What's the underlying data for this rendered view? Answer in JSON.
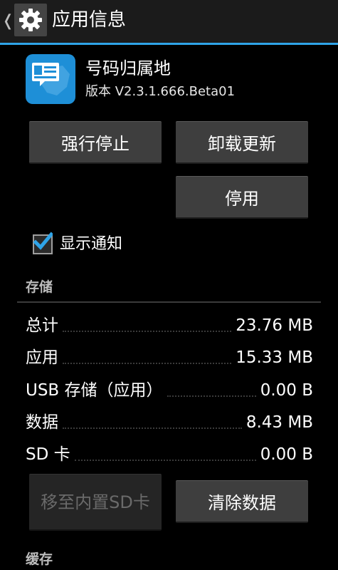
{
  "actionbar": {
    "title": "应用信息",
    "back_glyph": "❬",
    "icon": "gear-icon"
  },
  "app": {
    "name": "号码归属地",
    "version": "版本 V2.3.1.666.Beta01",
    "icon": "id-card-map-icon"
  },
  "buttons": {
    "force_stop": "强行停止",
    "uninstall_updates": "卸载更新",
    "disable": "停用",
    "move_to_internal": "移至内置SD卡",
    "clear_data": "清除数据"
  },
  "notification": {
    "label": "显示通知",
    "checked": true
  },
  "storage": {
    "title": "存储",
    "rows": [
      {
        "label": "总计",
        "value": "23.76 MB"
      },
      {
        "label": "应用",
        "value": "15.33 MB"
      },
      {
        "label": "USB 存储（应用）",
        "value": "0.00 B"
      },
      {
        "label": "数据",
        "value": "8.43 MB"
      },
      {
        "label": "SD 卡",
        "value": "0.00 B"
      }
    ]
  },
  "cache": {
    "title": "缓存"
  },
  "colors": {
    "accent": "#2fa4e8",
    "background": "#000000",
    "button": "#3e3e3e",
    "app_icon": "#1e8fd7"
  }
}
